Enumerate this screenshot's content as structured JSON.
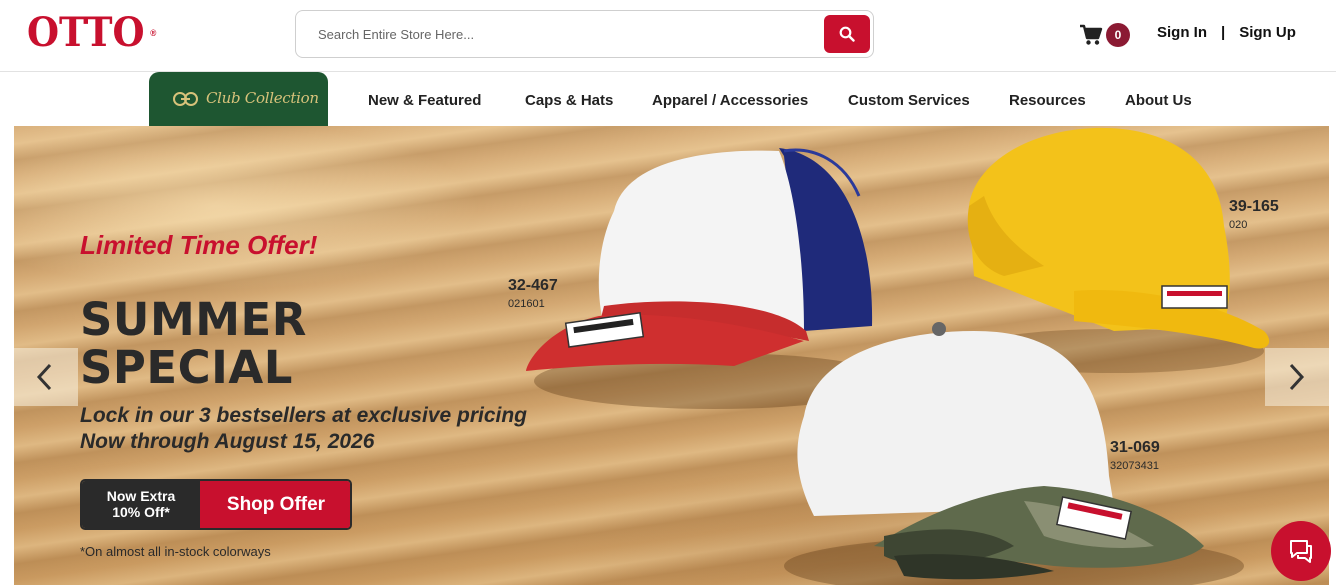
{
  "brand": {
    "logo_text": "OTTO",
    "registered_mark": "®"
  },
  "search": {
    "placeholder": "Search Entire Store Here...",
    "button_icon": "search-icon"
  },
  "cart": {
    "icon": "cart-icon",
    "count": "0"
  },
  "auth": {
    "sign_in": "Sign In",
    "separator": "|",
    "sign_up": "Sign Up"
  },
  "nav": {
    "club_label": "Club Collection",
    "items": [
      "New & Featured",
      "Caps & Hats",
      "Apparel / Accessories",
      "Custom Services",
      "Resources",
      "About Us"
    ]
  },
  "hero": {
    "offer_title": "Limited Time Offer!",
    "headline_line1": "SUMMER",
    "headline_line2": "SPECIAL",
    "subline1": "Lock in our 3 bestsellers at exclusive pricing",
    "subline2": "Now through August 15, 2026",
    "cta_left_line1": "Now Extra",
    "cta_left_line2": "10% Off*",
    "cta_right": "Shop Offer",
    "footnote": "*On almost all in-stock colorways",
    "products": [
      {
        "code": "32-467",
        "color_code": "021601"
      },
      {
        "code": "39-165",
        "color_code": "020"
      },
      {
        "code": "31-069",
        "color_code": "32073431"
      }
    ]
  },
  "colors": {
    "brand_red": "#c8102e",
    "club_green": "#1e5631",
    "badge_maroon": "#8b1a33"
  },
  "icons": {
    "prev": "chevron-left-icon",
    "next": "chevron-right-icon",
    "chat": "chat-icon"
  }
}
